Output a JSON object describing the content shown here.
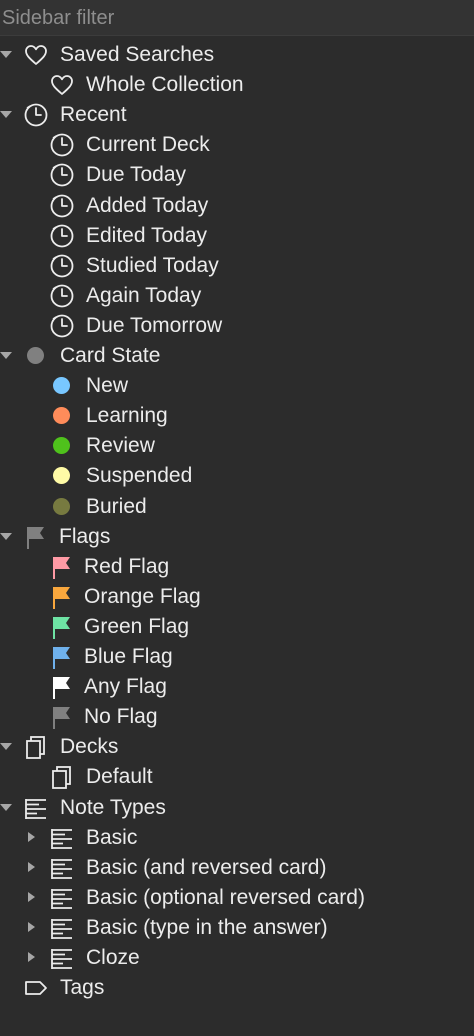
{
  "filter": {
    "placeholder": "Sidebar filter"
  },
  "saved_searches": {
    "label": "Saved Searches",
    "items": [
      "Whole Collection"
    ]
  },
  "recent": {
    "label": "Recent",
    "items": [
      "Current Deck",
      "Due Today",
      "Added Today",
      "Edited Today",
      "Studied Today",
      "Again Today",
      "Due Tomorrow"
    ]
  },
  "card_state": {
    "label": "Card State",
    "items": [
      {
        "label": "New",
        "color": "#78c7ff"
      },
      {
        "label": "Learning",
        "color": "#ff8c5a"
      },
      {
        "label": "Review",
        "color": "#4fc21c"
      },
      {
        "label": "Suspended",
        "color": "#fffba6"
      },
      {
        "label": "Buried",
        "color": "#777a40"
      }
    ],
    "color": "#808080"
  },
  "flags": {
    "label": "Flags",
    "color": "#808080",
    "items": [
      {
        "label": "Red Flag",
        "color": "#ff9aa5"
      },
      {
        "label": "Orange Flag",
        "color": "#f9a73d"
      },
      {
        "label": "Green Flag",
        "color": "#6ee3a4"
      },
      {
        "label": "Blue Flag",
        "color": "#6fb1ec"
      },
      {
        "label": "Any Flag",
        "color": "#ffffff"
      },
      {
        "label": "No Flag",
        "color": "#808080"
      }
    ]
  },
  "decks": {
    "label": "Decks",
    "items": [
      "Default"
    ]
  },
  "note_types": {
    "label": "Note Types",
    "items": [
      "Basic",
      "Basic (and reversed card)",
      "Basic (optional reversed card)",
      "Basic (type in the answer)",
      "Cloze"
    ]
  },
  "tags": {
    "label": "Tags"
  }
}
